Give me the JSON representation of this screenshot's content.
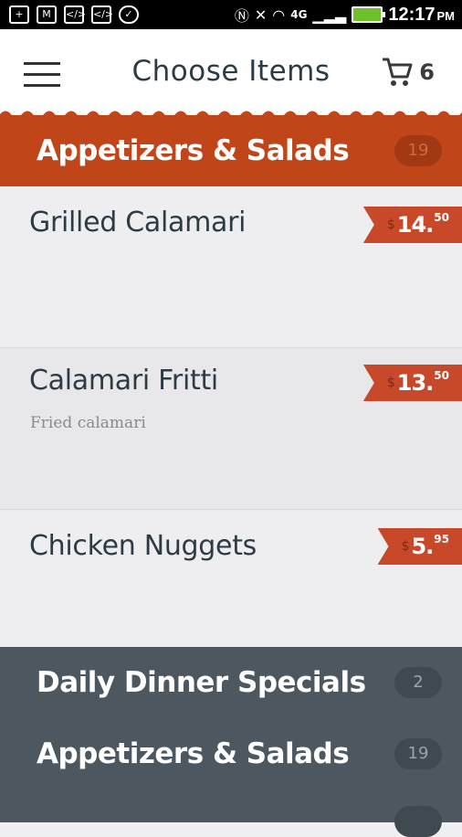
{
  "status_bar": {
    "time": "12:17",
    "ampm": "PM",
    "network": "4G"
  },
  "header": {
    "title": "Choose Items",
    "cart_count": "6"
  },
  "sections": [
    {
      "name": "Appetizers & Salads",
      "count": "19"
    },
    {
      "name": "Daily Dinner Specials",
      "count": "2"
    },
    {
      "name": "Appetizers & Salads",
      "count": "19"
    }
  ],
  "items": [
    {
      "name": "Grilled Calamari",
      "desc": "",
      "currency": "$",
      "price_main": "14.",
      "price_cents": "50"
    },
    {
      "name": "Calamari Fritti",
      "desc": "Fried calamari",
      "currency": "$",
      "price_main": "13.",
      "price_cents": "50"
    },
    {
      "name": "Chicken Nuggets",
      "desc": "",
      "currency": "$",
      "price_main": "5.",
      "price_cents": "95"
    }
  ],
  "colors": {
    "accent": "#c0461a",
    "price_tag": "#c8492a",
    "dark_panel": "#4c5760"
  }
}
